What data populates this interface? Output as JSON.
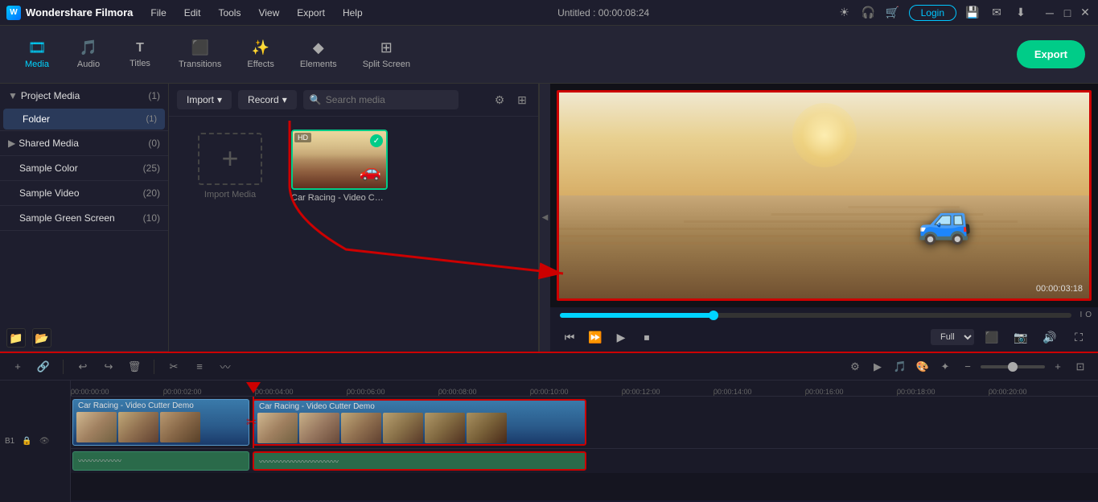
{
  "app": {
    "title": "Wondershare Filmora",
    "project_title": "Untitled : 00:00:08:24"
  },
  "menu": {
    "items": [
      "File",
      "Edit",
      "Tools",
      "View",
      "Export",
      "Help"
    ]
  },
  "toolbar": {
    "items": [
      {
        "id": "media",
        "label": "Media",
        "icon": "🎞"
      },
      {
        "id": "audio",
        "label": "Audio",
        "icon": "🎵"
      },
      {
        "id": "titles",
        "label": "Titles",
        "icon": "T"
      },
      {
        "id": "transitions",
        "label": "Transitions",
        "icon": "⬛"
      },
      {
        "id": "effects",
        "label": "Effects",
        "icon": "✨"
      },
      {
        "id": "elements",
        "label": "Elements",
        "icon": "◆"
      },
      {
        "id": "splitscreen",
        "label": "Split Screen",
        "icon": "⊞"
      }
    ],
    "export_label": "Export"
  },
  "left_panel": {
    "project_media": {
      "label": "Project Media",
      "count": "(1)",
      "folder_label": "Folder",
      "folder_count": "(1)"
    },
    "shared_media": {
      "label": "Shared Media",
      "count": "(0)"
    },
    "sample_color": {
      "label": "Sample Color",
      "count": "(25)"
    },
    "sample_video": {
      "label": "Sample Video",
      "count": "(20)"
    },
    "sample_green_screen": {
      "label": "Sample Green Screen",
      "count": "(10)"
    }
  },
  "media_panel": {
    "import_label": "Import",
    "record_label": "Record",
    "search_placeholder": "Search media",
    "import_media_text": "Import Media",
    "clip_name": "Car Racing - Video Cutt...",
    "clip_full_name": "Car Racing - Video Cutter Demo"
  },
  "preview": {
    "timecode": "00:00:03:18",
    "zoom_level": "Full",
    "controls": {
      "prev_frame": "⏮",
      "play_slow": "⏩",
      "play": "▶",
      "stop": "⏹"
    }
  },
  "timeline": {
    "toolbar_buttons": [
      "↩",
      "↪",
      "🗑",
      "✂",
      "≡",
      "⋮"
    ],
    "time_markers": [
      "00:00:00:00",
      "00:00:02:00",
      "00:00:04:00",
      "00:00:06:00",
      "00:00:08:00",
      "00:00:10:00",
      "00:00:12:00",
      "00:00:14:00",
      "00:00:16:00",
      "00:00:18:00",
      "00:00:20:00"
    ],
    "clip1_label": "Car Racing - Video Cutter Demo",
    "clip2_label": "Car Racing - Video Cutter Demo"
  },
  "icons": {
    "search": "🔍",
    "filter": "⚙",
    "grid": "⊞",
    "undo": "↩",
    "redo": "↪",
    "delete": "🗑",
    "split": "✂",
    "adjust": "≡",
    "waveform": "〰"
  }
}
